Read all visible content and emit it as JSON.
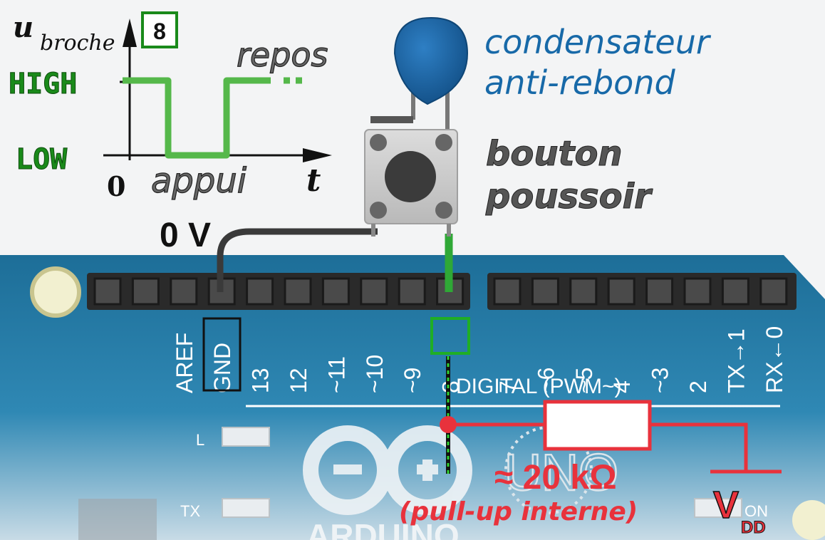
{
  "signal_graph": {
    "y_label_main": "u",
    "y_label_sub": "broche",
    "pin_badge": "8",
    "high_label": "HIGH",
    "low_label": "LOW",
    "origin_label": "0",
    "time_label": "t",
    "press_label": "appui",
    "rest_label": "repos"
  },
  "components": {
    "capacitor_label_line1": "condensateur",
    "capacitor_label_line2": "anti-rebond",
    "button_label_line1": "bouton",
    "button_label_line2": "poussoir",
    "ground_wire_label": "0 V"
  },
  "board": {
    "left_header_pins": [
      "AREF",
      "GND",
      "13",
      "12",
      "~11",
      "~10",
      "~9",
      "8"
    ],
    "right_header_pins": [
      "7",
      "~6",
      "~5",
      "4",
      "~3",
      "2",
      "TX→1",
      "RX←0"
    ],
    "digital_label": "DIGITAL (PWM~)",
    "led_l": "L",
    "led_tx": "TX",
    "uno_logo": "UNO",
    "on_label": "ON",
    "brand": "ARDUINO"
  },
  "pullup": {
    "value_label": "≈ 20 kΩ",
    "description": "(pull-up interne)",
    "vdd_main": "V",
    "vdd_sub": "DD"
  },
  "colors": {
    "board_blue": "#1d6e98",
    "signal_green": "#2fa836",
    "label_green": "#1a8a1a",
    "pullup_red": "#e8323c",
    "cap_blue": "#1769a8",
    "label_gray": "#555555"
  }
}
